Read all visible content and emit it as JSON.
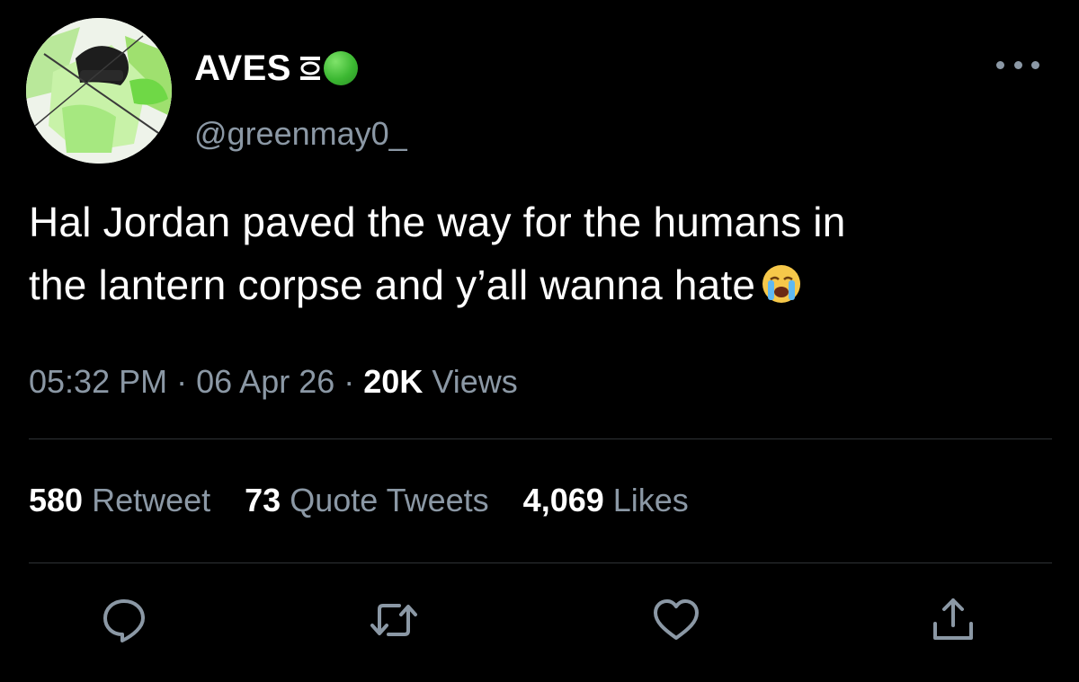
{
  "user": {
    "display_name": "AVES",
    "handle": "@greenmay0_",
    "badge_icons": [
      "lantern-icon",
      "green-circle-emoji"
    ]
  },
  "tweet": {
    "text_line1": "Hal Jordan paved the way for the humans in",
    "text_line2": "the lantern corpse and y’all wanna hate",
    "emoji": "loudly-crying-face-emoji"
  },
  "meta": {
    "time": "05:32 PM",
    "separator": "·",
    "date": "06 Apr 26",
    "views_count": "20K",
    "views_label": "Views"
  },
  "stats": {
    "retweets_count": "580",
    "retweets_label": "Retweet",
    "quotes_count": "73",
    "quotes_label": "Quote Tweets",
    "likes_count": "4,069",
    "likes_label": "Likes"
  },
  "actions": [
    "reply-icon",
    "retweet-icon",
    "like-icon",
    "share-icon"
  ],
  "colors": {
    "background": "#000000",
    "text_primary": "#ffffff",
    "text_secondary": "#8b98a5",
    "divider": "#2f3336",
    "accent_green": "#3cb832"
  }
}
